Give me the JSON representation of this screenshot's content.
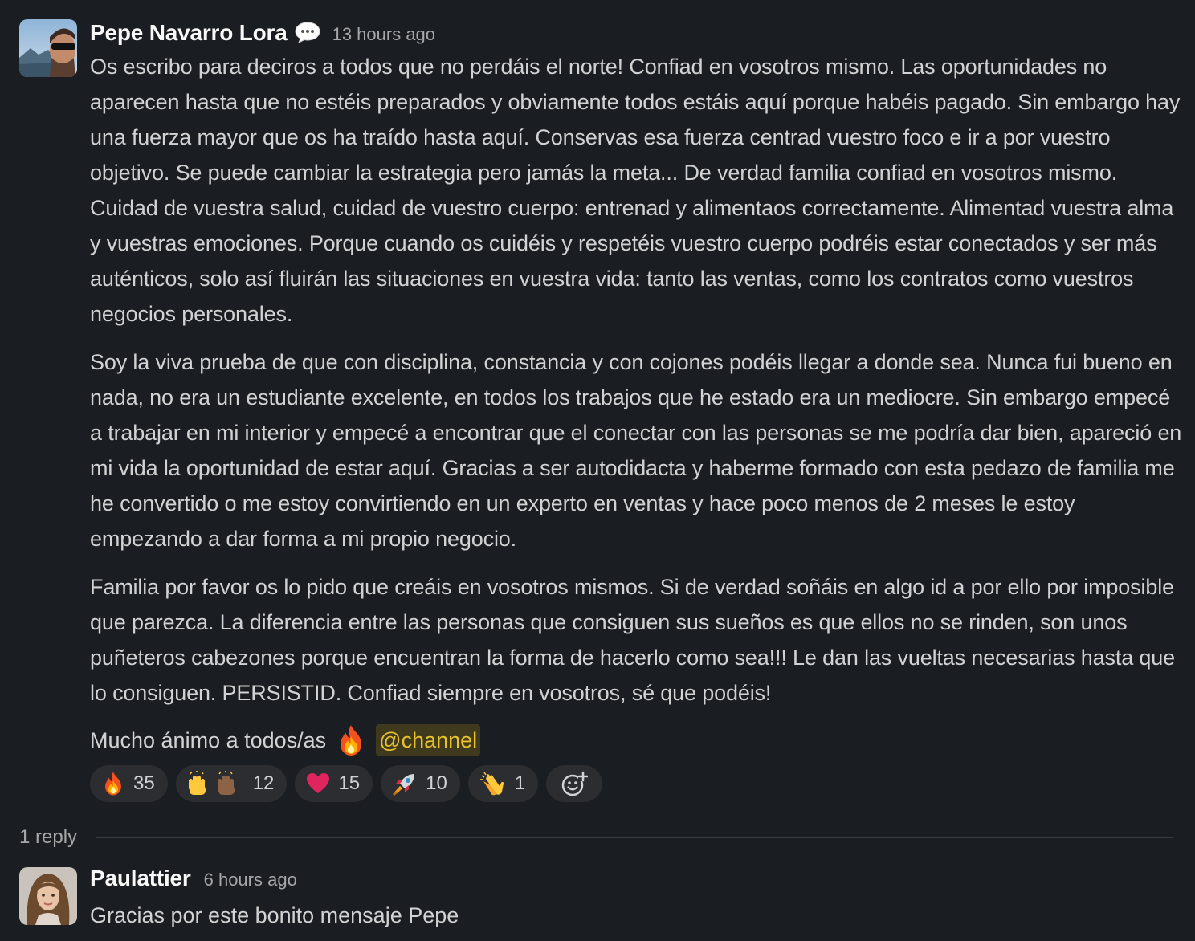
{
  "main_message": {
    "author": "Pepe Navarro Lora",
    "status_icon": "speech-bubble-icon",
    "timestamp": "13 hours ago",
    "paragraphs": [
      "Os escribo para deciros a todos que no perdáis el norte! Confiad en vosotros mismo. Las oportunidades no aparecen hasta que no estéis preparados y obviamente todos estáis aquí porque habéis pagado. Sin embargo hay una fuerza mayor que os ha traído hasta aquí. Conservas esa fuerza centrad vuestro foco e ir a por vuestro objetivo. Se puede cambiar la estrategia pero jamás la meta... De verdad familia confiad en vosotros mismo. Cuidad de vuestra salud, cuidad de vuestro cuerpo: entrenad y alimentaos correctamente. Alimentad vuestra alma y vuestras emociones. Porque cuando os cuidéis y respetéis vuestro cuerpo podréis estar conectados y ser más auténticos, solo así fluirán las situaciones en vuestra vida: tanto las ventas, como los contratos como vuestros negocios personales.",
      "Soy la viva prueba de que con disciplina, constancia y con cojones podéis llegar a donde sea. Nunca fui bueno en nada, no era un estudiante excelente, en todos los trabajos que he estado era un mediocre. Sin embargo empecé a trabajar en mi interior y empecé a encontrar que el conectar con las personas se me podría dar bien, apareció en mi vida la oportunidad de estar aquí. Gracias a ser autodidacta y haberme formado con esta pedazo de familia me he convertido o me estoy convirtiendo en un experto en ventas y hace poco menos de 2 meses le estoy empezando a dar forma a mi propio negocio.",
      "Familia por favor os lo pido que creáis en vosotros mismos. Si de verdad soñáis en algo id a por ello por imposible que parezca. La diferencia entre las personas que consiguen sus sueños es que ellos no se rinden, son unos puñeteros cabezones porque encuentran la forma de hacerlo como sea!!! Le dan las vueltas necesarias hasta que lo consiguen. PERSISTID. Confiad siempre en vosotros, sé que podéis!"
    ],
    "closing_text": "Mucho ánimo a todos/as",
    "closing_emoji": "fire-icon",
    "mention": "@channel",
    "reactions": [
      {
        "emoji": "fire",
        "count": "35"
      },
      {
        "emoji": "raised-hands",
        "count": "12"
      },
      {
        "emoji": "red-heart",
        "count": "15"
      },
      {
        "emoji": "rocket",
        "count": "10"
      },
      {
        "emoji": "clapping-hands",
        "count": "1"
      }
    ],
    "add_reaction_icon": "add-emoji-icon"
  },
  "thread": {
    "reply_count": "1 reply"
  },
  "reply_message": {
    "author": "Paulattier",
    "timestamp": "6 hours ago",
    "text": "Gracias por este bonito mensaje Pepe"
  },
  "colors": {
    "background": "#1a1d21",
    "text": "#d1d2d3",
    "author": "#f8f8f8",
    "muted": "#a6a7a9",
    "reaction_bg": "#2c2d30",
    "mention_bg": "#3f3a1e",
    "mention_text": "#e8c22e"
  }
}
